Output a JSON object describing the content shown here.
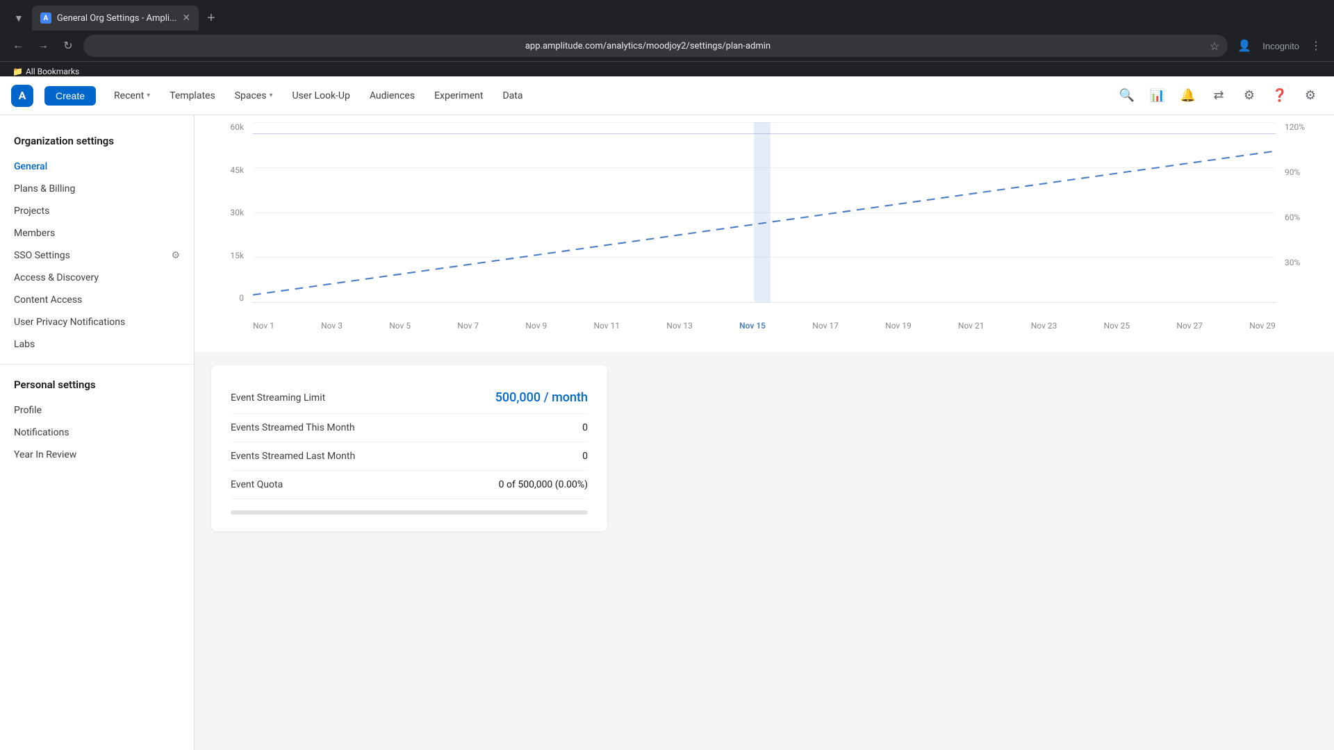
{
  "browser": {
    "tab_title": "General Org Settings - Ampli...",
    "url": "app.amplitude.com/analytics/moodjoy2/settings/plan-admin",
    "incognito_label": "Incognito",
    "bookmarks_label": "All Bookmarks"
  },
  "nav": {
    "logo_letter": "A",
    "create_label": "Create",
    "items": [
      {
        "label": "Recent",
        "has_chevron": true
      },
      {
        "label": "Templates",
        "has_chevron": false
      },
      {
        "label": "Spaces",
        "has_chevron": true
      },
      {
        "label": "User Look-Up",
        "has_chevron": false
      },
      {
        "label": "Audiences",
        "has_chevron": false
      },
      {
        "label": "Experiment",
        "has_chevron": false
      },
      {
        "label": "Data",
        "has_chevron": false
      }
    ]
  },
  "sidebar": {
    "org_section_title": "Organization settings",
    "org_items": [
      {
        "label": "General",
        "active": true
      },
      {
        "label": "Plans & Billing",
        "active": false
      },
      {
        "label": "Projects",
        "active": false
      },
      {
        "label": "Members",
        "active": false
      },
      {
        "label": "SSO Settings",
        "active": false,
        "has_icon": true
      },
      {
        "label": "Access & Discovery",
        "active": false
      },
      {
        "label": "Content Access",
        "active": false
      },
      {
        "label": "User Privacy Notifications",
        "active": false
      },
      {
        "label": "Labs",
        "active": false
      }
    ],
    "personal_section_title": "Personal settings",
    "personal_items": [
      {
        "label": "Profile",
        "active": false
      },
      {
        "label": "Notifications",
        "active": false
      },
      {
        "label": "Year In Review",
        "active": false
      }
    ]
  },
  "chart": {
    "y_labels_left": [
      "60k",
      "45k",
      "30k",
      "15k",
      "0"
    ],
    "y_labels_right": [
      "120%",
      "90%",
      "60%",
      "30%",
      ""
    ],
    "x_labels": [
      "Nov 1",
      "Nov 3",
      "Nov 5",
      "Nov 7",
      "Nov 9",
      "Nov 11",
      "Nov 13",
      "Nov 15",
      "Nov 17",
      "Nov 19",
      "Nov 21",
      "Nov 23",
      "Nov 25",
      "Nov 27",
      "Nov 29"
    ]
  },
  "stats": {
    "event_streaming_limit_label": "Event Streaming Limit",
    "event_streaming_limit_value": "500,000 / month",
    "events_this_month_label": "Events Streamed This Month",
    "events_this_month_value": "0",
    "events_last_month_label": "Events Streamed Last Month",
    "events_last_month_value": "0",
    "event_quota_label": "Event Quota",
    "event_quota_value": "0 of 500,000 (0.00%)",
    "progress_percent": 0
  }
}
